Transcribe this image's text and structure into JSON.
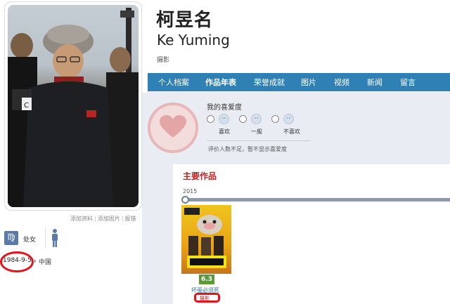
{
  "person": {
    "name_cn": "柯昱名",
    "name_en": "Ke Yuming",
    "role": "摄影"
  },
  "photo_links": [
    "添加资料",
    "添加图片",
    "报错"
  ],
  "profile": {
    "zodiac_icon": "♍",
    "zodiac": "处女",
    "gender_icon": "male-person-icon",
    "birth_date": "1984-9-5",
    "country": "中国"
  },
  "nav": {
    "items": [
      "个人档案",
      "作品年表",
      "荣誉成就",
      "图片",
      "视频",
      "新闻",
      "留言"
    ],
    "active": "作品年表"
  },
  "rating": {
    "title": "我的喜爱度",
    "options": [
      "喜欢",
      "一般",
      "不喜欢"
    ],
    "note": "评价人数不足，暂不显示喜爱度"
  },
  "works": {
    "title": "主要作品",
    "year": "2015",
    "movies": [
      {
        "title": "坏蛋必须死",
        "score": "6.3",
        "role": "摄影"
      }
    ]
  },
  "colors": {
    "nav_bg": "#2f80b5",
    "annotation_red": "#e2141b",
    "works_title": "#c41d1d",
    "score_bg": "#5b9a37"
  }
}
